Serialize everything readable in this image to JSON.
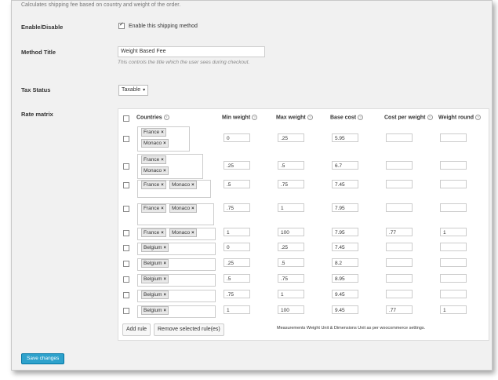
{
  "description": "Calculates shipping fee based on country and weight of the order.",
  "enable": {
    "label": "Enable/Disable",
    "checkbox_text": "Enable this shipping method",
    "checked": true
  },
  "method_title": {
    "label": "Method Title",
    "value": "Weight Based Fee",
    "hint": "This controls the title which the user sees during checkout."
  },
  "tax_status": {
    "label": "Tax Status",
    "value": "Taxable"
  },
  "rate_matrix": {
    "label": "Rate matrix",
    "headers": {
      "countries": "Countries",
      "min_weight": "Min weight",
      "max_weight": "Max weight",
      "base_cost": "Base cost",
      "cost_per_weight": "Cost per weight",
      "weight_round": "Weight round"
    },
    "rows": [
      {
        "countries": [
          "France",
          "Monaco"
        ],
        "min": "0",
        "max": ".25",
        "base": "5.95",
        "cpw": "",
        "round": ""
      },
      {
        "countries": [
          "France",
          "Monaco"
        ],
        "min": ".25",
        "max": ".5",
        "base": "6.7",
        "cpw": "",
        "round": ""
      },
      {
        "countries": [
          "France",
          "Monaco"
        ],
        "min": ".5",
        "max": ".75",
        "base": "7.45",
        "cpw": "",
        "round": ""
      },
      {
        "countries": [
          "France",
          "Monaco"
        ],
        "min": ".75",
        "max": "1",
        "base": "7.95",
        "cpw": "",
        "round": ""
      },
      {
        "countries": [
          "France",
          "Monaco"
        ],
        "min": "1",
        "max": "100",
        "base": "7.95",
        "cpw": ".77",
        "round": "1"
      },
      {
        "countries": [
          "Belgium"
        ],
        "min": "0",
        "max": ".25",
        "base": "7.45",
        "cpw": "",
        "round": ""
      },
      {
        "countries": [
          "Belgium"
        ],
        "min": ".25",
        "max": ".5",
        "base": "8.2",
        "cpw": "",
        "round": ""
      },
      {
        "countries": [
          "Belgium"
        ],
        "min": ".5",
        "max": ".75",
        "base": "8.95",
        "cpw": "",
        "round": ""
      },
      {
        "countries": [
          "Belgium"
        ],
        "min": ".75",
        "max": "1",
        "base": "9.45",
        "cpw": "",
        "round": ""
      },
      {
        "countries": [
          "Belgium"
        ],
        "min": "1",
        "max": "100",
        "base": "9.45",
        "cpw": ".77",
        "round": "1"
      }
    ],
    "add_rule": "Add rule",
    "remove_rules": "Remove selected rule(es)",
    "note": "Measurements Weight Unit & Dimensions Unit as per woocommerce settings."
  },
  "save_button": "Save changes"
}
